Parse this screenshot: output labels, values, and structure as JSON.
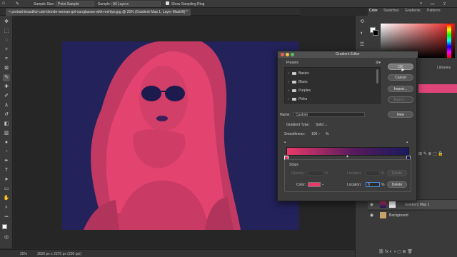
{
  "options_bar": {
    "sample_size_label": "Sample Size:",
    "sample_size_value": "Point Sample",
    "sample_label": "Sample:",
    "sample_value": "All Layers",
    "show_ring_label": "Show Sampling Ring"
  },
  "document_tab": {
    "title": "portrait-beautiful-cute-blonde-woman-girl-sunglasses-with-red-lips.jpg @ 25% (Gradient Map 1, Layer Mask/8) *"
  },
  "status_bar": {
    "zoom": "25%",
    "doc_size": "3000 px x 2375 px (300 ppi)"
  },
  "right_panel": {
    "tabs": [
      "Color",
      "Swatches",
      "Gradients",
      "Patterns"
    ],
    "libraries_tab": "Libraries",
    "layers": [
      {
        "name": "Gradient Map 1"
      },
      {
        "name": "Background"
      }
    ]
  },
  "gradient_editor": {
    "title": "Gradient Editor",
    "presets_label": "Presets",
    "presets": [
      "Basics",
      "Blues",
      "Purples",
      "Pinks"
    ],
    "ok_label": "OK",
    "cancel_label": "Cancel",
    "import_label": "Import...",
    "export_label": "Export...",
    "new_label": "New",
    "name_label": "Name:",
    "name_value": "Custom",
    "gradient_type_label": "Gradient Type:",
    "gradient_type_value": "Solid",
    "smoothness_label": "Smoothness:",
    "smoothness_value": "100",
    "smoothness_unit": "%",
    "stops_label": "Stops",
    "opacity_label": "Opacity:",
    "opacity_unit": "%",
    "location_label": "Location:",
    "location_unit": "%",
    "delete_label": "Delete",
    "color_label": "Color:",
    "color_location_label": "Location:",
    "color_location_value": "0",
    "color_location_unit": "%",
    "color_delete_label": "Delete",
    "gradient_colors": [
      "#e93a6b",
      "#571a5d",
      "#1a1a5e"
    ],
    "selected_stop_color": "#e93a6b"
  },
  "colors": {
    "image_pink": "#e5416f",
    "image_navy": "#23225a"
  }
}
